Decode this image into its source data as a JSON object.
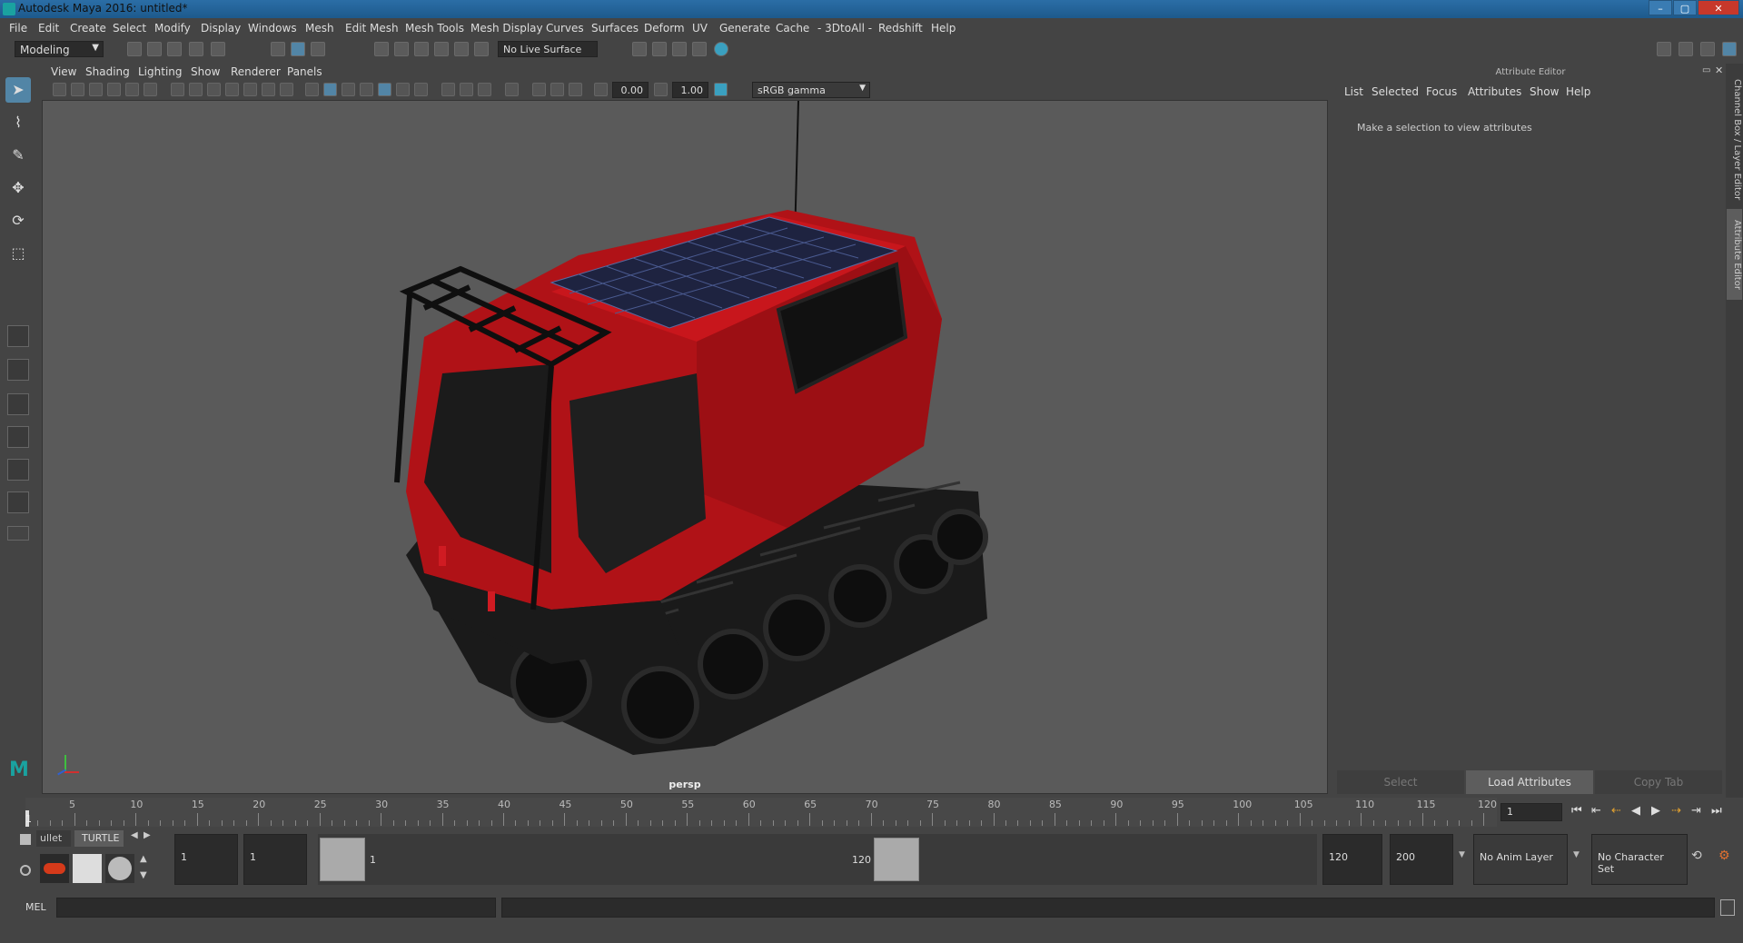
{
  "window": {
    "title": "Autodesk Maya 2016: untitled*",
    "min": "–",
    "max": "▢",
    "close": "✕"
  },
  "menu": [
    "File",
    "Edit",
    "Create",
    "Select",
    "Modify",
    "Display",
    "Windows",
    "Mesh",
    "Edit Mesh",
    "Mesh Tools",
    "Mesh Display",
    "Curves",
    "Surfaces",
    "Deform",
    "UV",
    "Generate",
    "Cache",
    "- 3DtoAll -",
    "Redshift",
    "Help"
  ],
  "statusline": {
    "mode": "Modeling",
    "live_surface": "No Live Surface"
  },
  "viewport": {
    "menu": [
      "View",
      "Shading",
      "Lighting",
      "Show",
      "Renderer",
      "Panels"
    ],
    "exposure": "0.00",
    "gamma": "1.00",
    "color_space": "sRGB gamma",
    "camera": "persp"
  },
  "attribute_editor": {
    "title": "Attribute Editor",
    "menu": [
      "List",
      "Selected",
      "Focus",
      "Attributes",
      "Show",
      "Help"
    ],
    "message": "Make a selection to view attributes",
    "buttons": {
      "select": "Select",
      "load": "Load Attributes",
      "copy": "Copy Tab"
    },
    "side_tabs": [
      "Channel Box / Layer Editor",
      "Attribute Editor"
    ]
  },
  "time_slider": {
    "labels": [
      "5",
      "10",
      "15",
      "20",
      "25",
      "30",
      "35",
      "40",
      "45",
      "50",
      "55",
      "60",
      "65",
      "70",
      "75",
      "80",
      "85",
      "90",
      "95",
      "100",
      "105",
      "110",
      "115",
      "120"
    ],
    "start_mark": "1",
    "current_frame": "1"
  },
  "shelf": {
    "tabs": [
      "ullet",
      "TURTLE"
    ]
  },
  "range": {
    "start": "1",
    "playback_start": "1",
    "handle_start": "1",
    "handle_end": "120",
    "playback_end": "120",
    "end": "200",
    "anim_layer": "No Anim Layer",
    "character_set": "No Character Set"
  },
  "command": {
    "label": "MEL"
  },
  "colors": {
    "accent": "#5285a6",
    "vehicle_body": "#c0141a",
    "viewport": "#5a5a5a"
  }
}
